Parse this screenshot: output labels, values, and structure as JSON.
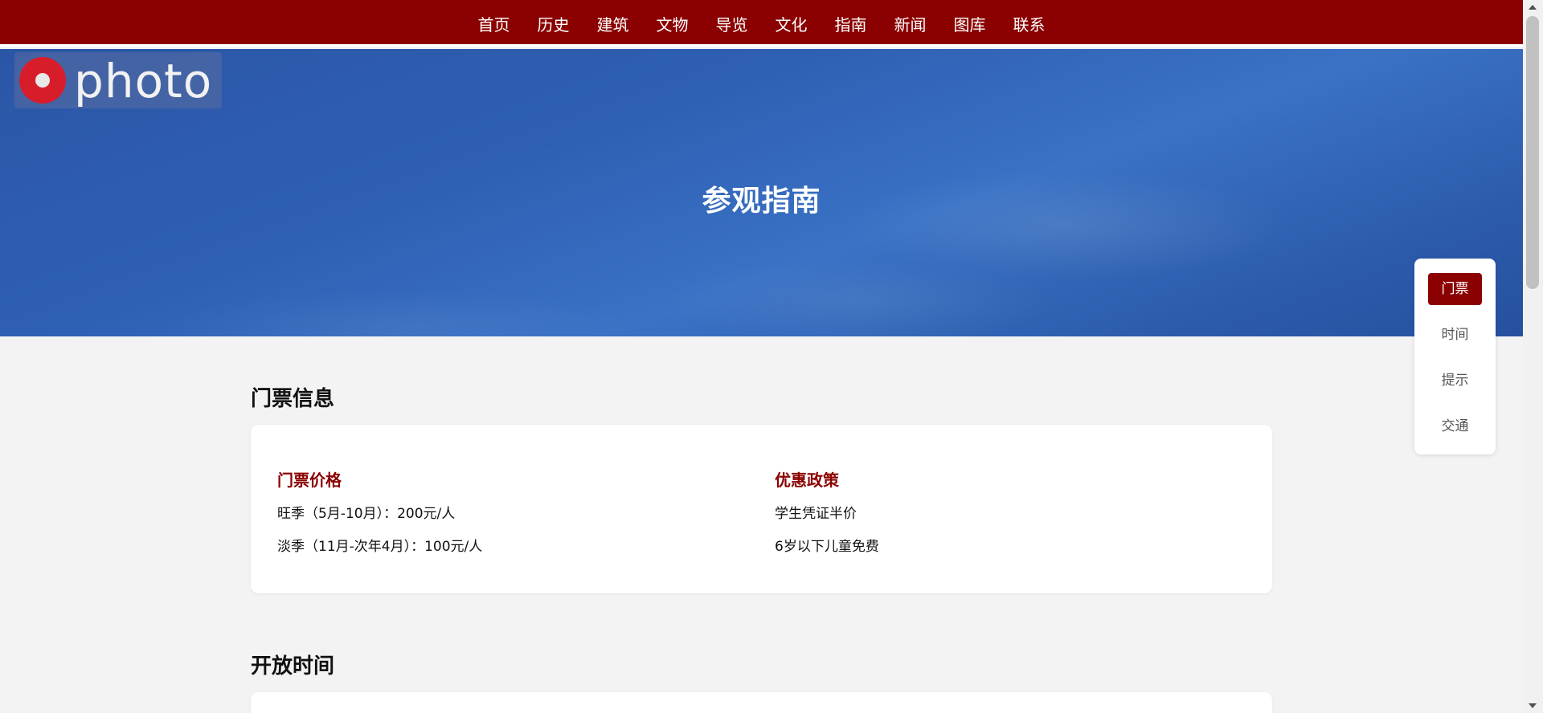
{
  "nav": {
    "items": [
      "首页",
      "历史",
      "建筑",
      "文物",
      "导览",
      "文化",
      "指南",
      "新闻",
      "图库",
      "联系"
    ]
  },
  "hero": {
    "title": "参观指南"
  },
  "watermark": {
    "text": "photo"
  },
  "sections": {
    "tickets": {
      "title": "门票信息",
      "price": {
        "heading": "门票价格",
        "lines": [
          "旺季（5月-10月）：200元/人",
          "淡季（11月-次年4月）：100元/人"
        ]
      },
      "discount": {
        "heading": "优惠政策",
        "lines": [
          "学生凭证半价",
          "6岁以下儿童免费"
        ]
      }
    },
    "hours": {
      "title": "开放时间"
    }
  },
  "sidenav": {
    "items": [
      "门票",
      "时间",
      "提示",
      "交通"
    ],
    "active": "门票"
  },
  "colors": {
    "brand": "#8b0000",
    "hero": "#2f5fb3",
    "background": "#f3f3f3"
  }
}
